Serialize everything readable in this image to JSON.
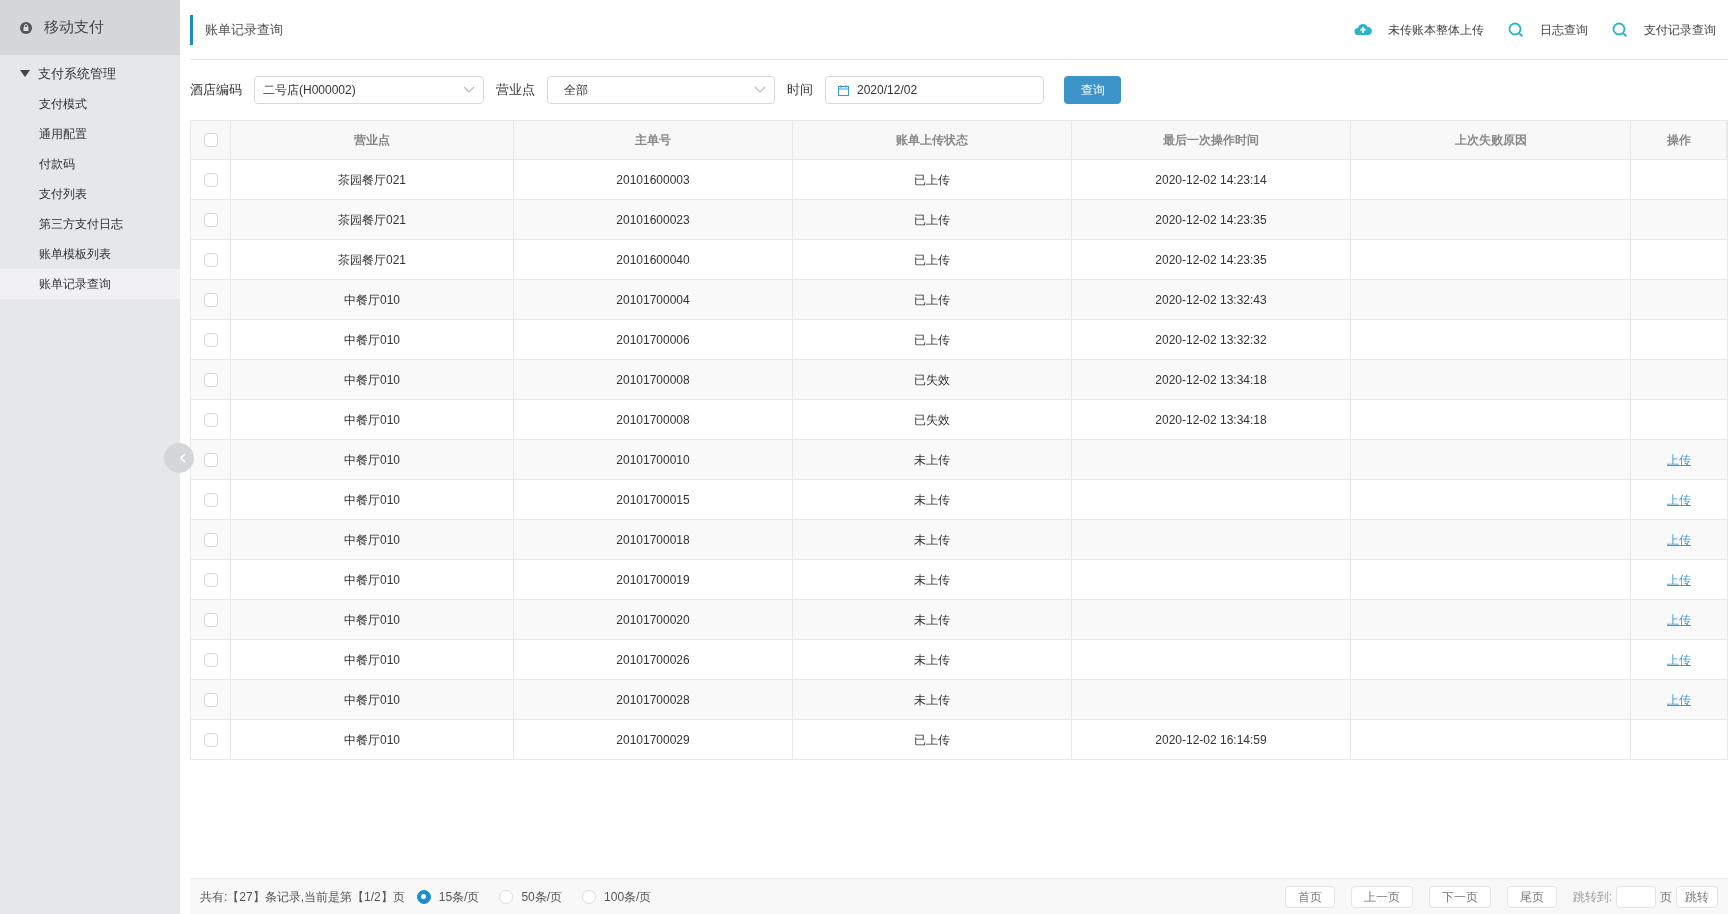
{
  "sidebar": {
    "title": "移动支付",
    "groups": [
      {
        "label": "支付系统管理",
        "expanded": true,
        "items": [
          {
            "label": "支付模式",
            "selected": false
          },
          {
            "label": "通用配置",
            "selected": false
          },
          {
            "label": "付款码",
            "selected": false
          },
          {
            "label": "支付列表",
            "selected": false
          },
          {
            "label": "第三方支付日志",
            "selected": false
          },
          {
            "label": "账单模板列表",
            "selected": false
          },
          {
            "label": "账单记录查询",
            "selected": true
          }
        ]
      }
    ]
  },
  "header": {
    "title": "账单记录查询",
    "actions": [
      {
        "kind": "upload",
        "label": "未传账本整体上传"
      },
      {
        "kind": "search",
        "label": "日志查询"
      },
      {
        "kind": "search",
        "label": "支付记录查询"
      }
    ]
  },
  "filters": {
    "hotel_label": "酒店编码",
    "hotel_value": "二号店(H000002)",
    "outlet_label": "营业点",
    "outlet_value": "全部",
    "time_label": "时间",
    "time_value": "2020/12/02",
    "query_button": "查询"
  },
  "table": {
    "select_all": false,
    "columns": [
      "营业点",
      "主单号",
      "账单上传状态",
      "最后一次操作时间",
      "上次失败原因",
      "操作"
    ],
    "rows": [
      {
        "checked": false,
        "outlet": "茶园餐厅021",
        "order": "20101600003",
        "status": "已上传",
        "time": "2020-12-02 14:23:14"
      },
      {
        "checked": false,
        "outlet": "茶园餐厅021",
        "order": "20101600023",
        "status": "已上传",
        "time": "2020-12-02 14:23:35"
      },
      {
        "checked": false,
        "outlet": "茶园餐厅021",
        "order": "20101600040",
        "status": "已上传",
        "time": "2020-12-02 14:23:35"
      },
      {
        "checked": false,
        "outlet": "中餐厅010",
        "order": "20101700004",
        "status": "已上传",
        "time": "2020-12-02 13:32:43"
      },
      {
        "checked": false,
        "outlet": "中餐厅010",
        "order": "20101700006",
        "status": "已上传",
        "time": "2020-12-02 13:32:32"
      },
      {
        "checked": false,
        "outlet": "中餐厅010",
        "order": "20101700008",
        "status": "已失效",
        "time": "2020-12-02 13:34:18"
      },
      {
        "checked": false,
        "outlet": "中餐厅010",
        "order": "20101700008",
        "status": "已失效",
        "time": "2020-12-02 13:34:18"
      },
      {
        "checked": false,
        "outlet": "中餐厅010",
        "order": "20101700010",
        "status": "未上传",
        "action": "上传"
      },
      {
        "checked": false,
        "outlet": "中餐厅010",
        "order": "20101700015",
        "status": "未上传",
        "action": "上传"
      },
      {
        "checked": false,
        "outlet": "中餐厅010",
        "order": "20101700018",
        "status": "未上传",
        "action": "上传"
      },
      {
        "checked": false,
        "outlet": "中餐厅010",
        "order": "20101700019",
        "status": "未上传",
        "action": "上传"
      },
      {
        "checked": false,
        "outlet": "中餐厅010",
        "order": "20101700020",
        "status": "未上传",
        "action": "上传"
      },
      {
        "checked": false,
        "outlet": "中餐厅010",
        "order": "20101700026",
        "status": "未上传",
        "action": "上传"
      },
      {
        "checked": false,
        "outlet": "中餐厅010",
        "order": "20101700028",
        "status": "未上传",
        "action": "上传"
      },
      {
        "checked": false,
        "outlet": "中餐厅010",
        "order": "20101700029",
        "status": "已上传",
        "time": "2020-12-02 16:14:59"
      }
    ]
  },
  "footer": {
    "summary": "共有:【27】条记录,当前是第【1/2】页",
    "page_sizes": [
      {
        "label": "15条/页",
        "selected": true
      },
      {
        "label": "50条/页",
        "selected": false
      },
      {
        "label": "100条/页",
        "selected": false
      }
    ],
    "buttons": [
      "首页",
      "上一页",
      "下一页",
      "尾页"
    ],
    "jump_label": "跳转到:",
    "page_unit": "页",
    "jump_button": "跳转"
  }
}
